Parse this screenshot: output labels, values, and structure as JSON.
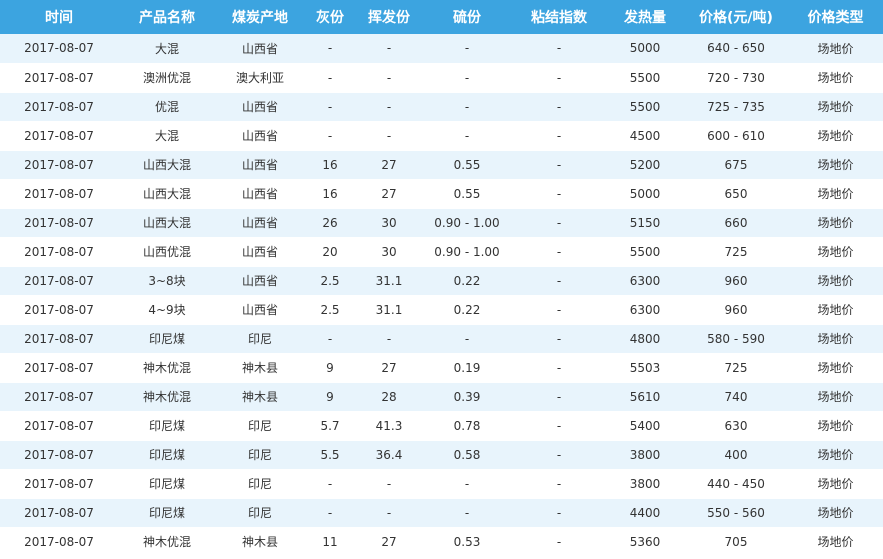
{
  "table": {
    "columns": [
      "时间",
      "产品名称",
      "煤炭产地",
      "灰份",
      "挥发份",
      "硫份",
      "粘结指数",
      "发热量",
      "价格(元/吨)",
      "价格类型"
    ],
    "rows": [
      [
        "2017-08-07",
        "大混",
        "山西省",
        "-",
        "-",
        "-",
        "-",
        "5000",
        "640 - 650",
        "场地价"
      ],
      [
        "2017-08-07",
        "澳洲优混",
        "澳大利亚",
        "-",
        "-",
        "-",
        "-",
        "5500",
        "720 - 730",
        "场地价"
      ],
      [
        "2017-08-07",
        "优混",
        "山西省",
        "-",
        "-",
        "-",
        "-",
        "5500",
        "725 - 735",
        "场地价"
      ],
      [
        "2017-08-07",
        "大混",
        "山西省",
        "-",
        "-",
        "-",
        "-",
        "4500",
        "600 - 610",
        "场地价"
      ],
      [
        "2017-08-07",
        "山西大混",
        "山西省",
        "16",
        "27",
        "0.55",
        "-",
        "5200",
        "675",
        "场地价"
      ],
      [
        "2017-08-07",
        "山西大混",
        "山西省",
        "16",
        "27",
        "0.55",
        "-",
        "5000",
        "650",
        "场地价"
      ],
      [
        "2017-08-07",
        "山西大混",
        "山西省",
        "26",
        "30",
        "0.90 - 1.00",
        "-",
        "5150",
        "660",
        "场地价"
      ],
      [
        "2017-08-07",
        "山西优混",
        "山西省",
        "20",
        "30",
        "0.90 - 1.00",
        "-",
        "5500",
        "725",
        "场地价"
      ],
      [
        "2017-08-07",
        "3~8块",
        "山西省",
        "2.5",
        "31.1",
        "0.22",
        "-",
        "6300",
        "960",
        "场地价"
      ],
      [
        "2017-08-07",
        "4~9块",
        "山西省",
        "2.5",
        "31.1",
        "0.22",
        "-",
        "6300",
        "960",
        "场地价"
      ],
      [
        "2017-08-07",
        "印尼煤",
        "印尼",
        "-",
        "-",
        "-",
        "-",
        "4800",
        "580 - 590",
        "场地价"
      ],
      [
        "2017-08-07",
        "神木优混",
        "神木县",
        "9",
        "27",
        "0.19",
        "-",
        "5503",
        "725",
        "场地价"
      ],
      [
        "2017-08-07",
        "神木优混",
        "神木县",
        "9",
        "28",
        "0.39",
        "-",
        "5610",
        "740",
        "场地价"
      ],
      [
        "2017-08-07",
        "印尼煤",
        "印尼",
        "5.7",
        "41.3",
        "0.78",
        "-",
        "5400",
        "630",
        "场地价"
      ],
      [
        "2017-08-07",
        "印尼煤",
        "印尼",
        "5.5",
        "36.4",
        "0.58",
        "-",
        "3800",
        "400",
        "场地价"
      ],
      [
        "2017-08-07",
        "印尼煤",
        "印尼",
        "-",
        "-",
        "-",
        "-",
        "3800",
        "440 - 450",
        "场地价"
      ],
      [
        "2017-08-07",
        "印尼煤",
        "印尼",
        "-",
        "-",
        "-",
        "-",
        "4400",
        "550 - 560",
        "场地价"
      ],
      [
        "2017-08-07",
        "神木优混",
        "神木县",
        "11",
        "27",
        "0.53",
        "-",
        "5360",
        "705",
        "场地价"
      ]
    ]
  }
}
